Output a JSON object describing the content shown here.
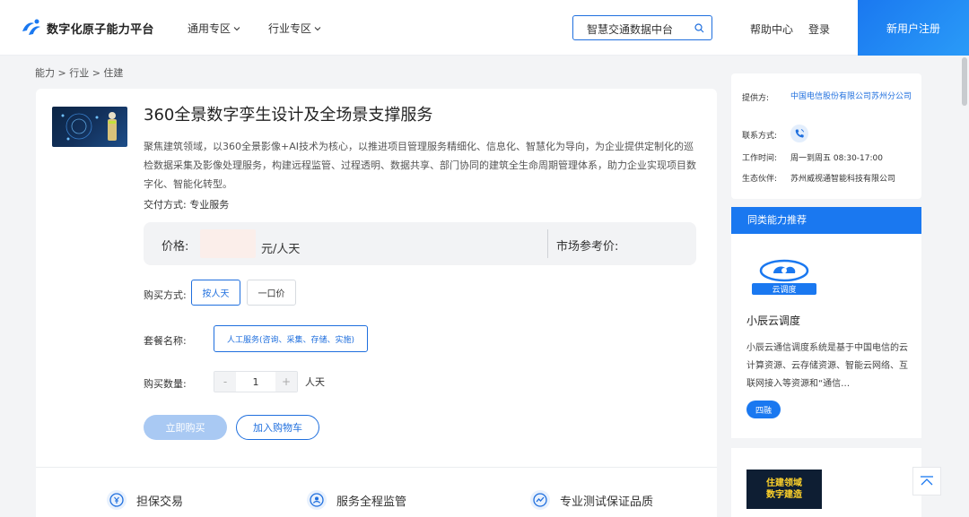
{
  "header": {
    "app_title": "数字化原子能力平台",
    "nav": [
      {
        "label": "通用专区"
      },
      {
        "label": "行业专区"
      }
    ],
    "search": {
      "value": "智慧交通数据中台",
      "placeholder": ""
    },
    "help_label": "帮助中心",
    "login_label": "登录",
    "register_label": "新用户注册",
    "accent_color": "#1a78f0"
  },
  "breadcrumb": {
    "text": "能力 > 行业 > 住建"
  },
  "product": {
    "title": "360全景数字孪生设计及全场景支撑服务",
    "description": "聚焦建筑领域，以360全景影像+AI技术为核心，以推进项目管理服务精细化、信息化、智慧化为导向，为企业提供定制化的巡检数据采集及影像处理服务，构建远程监管、过程透明、数据共享、部门协同的建筑全生命周期管理体系，助力企业实现项目数字化、智能化转型。",
    "delivery": "交付方式:  专业服务",
    "price_label": "价格:",
    "price_unit": "元/人天",
    "market_price_label": "市场参考价:",
    "purchase_mode_label": "购买方式:",
    "purchase_modes": [
      {
        "label": "按人天",
        "active": true
      },
      {
        "label": "一口价",
        "active": false
      }
    ],
    "package_label": "套餐名称:",
    "package_option": "人工服务(咨询、采集、存储、实施)",
    "quantity_label": "购买数量:",
    "quantity": "1",
    "quantity_unit": "人天",
    "minus": "-",
    "plus": "+",
    "buy_now": "立即购买",
    "add_cart": "加入购物车",
    "features": [
      {
        "label": "担保交易",
        "icon": "shield-money-icon"
      },
      {
        "label": "服务全程监管",
        "icon": "supervise-icon"
      },
      {
        "label": "专业测试保证品质",
        "icon": "quality-icon"
      }
    ]
  },
  "provider": {
    "provider_label": "提供方:",
    "provider_value": "中国电信股份有限公司苏州分公司",
    "contact_label": "联系方式:",
    "hours_label": "工作时间:",
    "hours_value": "周一到周五 08:30-17:00",
    "partner_label": "生态伙伴:",
    "partner_value": "苏州威视通智能科技有限公司"
  },
  "recommend": {
    "header": "同类能力推荐",
    "items": [
      {
        "logo_text": "云调度",
        "name": "小辰云调度",
        "description": "小辰云通信调度系统是基于中国电信的云计算资源、云存储资源、智能云网络、互联网接入等资源和“通信…",
        "tag": "四融"
      },
      {
        "image_text_line1": "住建领域",
        "image_text_line2": "数字建造"
      }
    ]
  }
}
